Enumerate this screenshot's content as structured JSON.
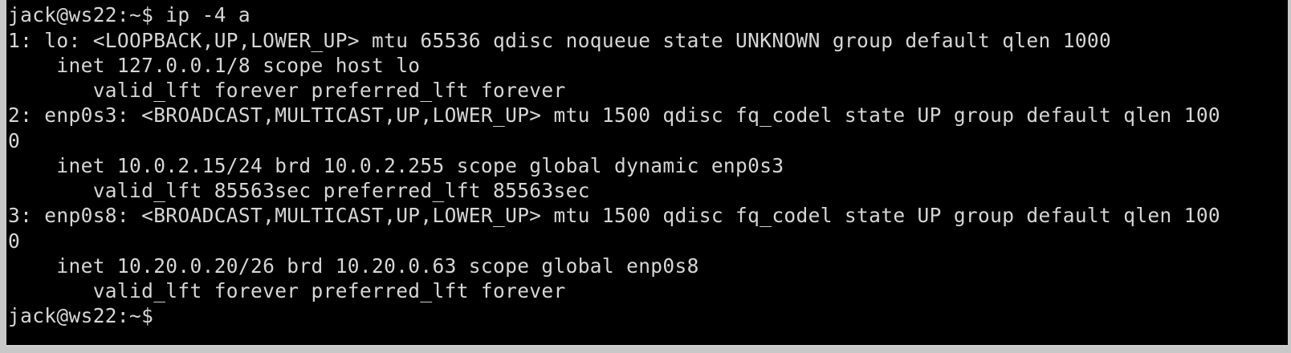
{
  "terminal": {
    "lines": [
      "jack@ws22:~$ ip -4 a",
      "1: lo: <LOOPBACK,UP,LOWER_UP> mtu 65536 qdisc noqueue state UNKNOWN group default qlen 1000",
      "    inet 127.0.0.1/8 scope host lo",
      "       valid_lft forever preferred_lft forever",
      "2: enp0s3: <BROADCAST,MULTICAST,UP,LOWER_UP> mtu 1500 qdisc fq_codel state UP group default qlen 100",
      "0",
      "    inet 10.0.2.15/24 brd 10.0.2.255 scope global dynamic enp0s3",
      "       valid_lft 85563sec preferred_lft 85563sec",
      "3: enp0s8: <BROADCAST,MULTICAST,UP,LOWER_UP> mtu 1500 qdisc fq_codel state UP group default qlen 100",
      "0",
      "    inet 10.20.0.20/26 brd 10.20.0.63 scope global enp0s8",
      "       valid_lft forever preferred_lft forever",
      "jack@ws22:~$"
    ]
  },
  "colors": {
    "background": "#000000",
    "foreground": "#d6d6d6",
    "frame": "#c8c8c8"
  }
}
